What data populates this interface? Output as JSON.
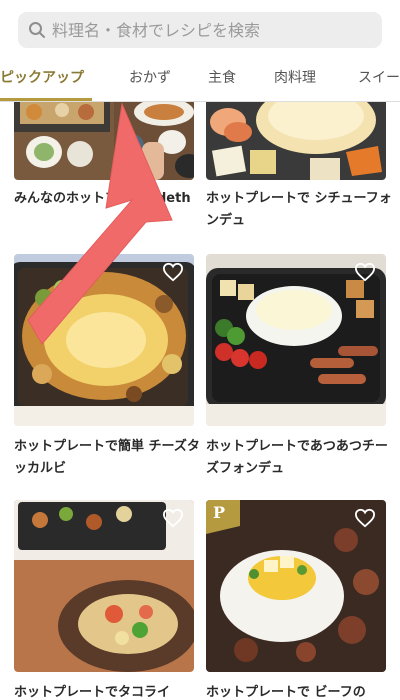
{
  "search": {
    "placeholder": "料理名・食材でレシピを検索"
  },
  "tabs": [
    {
      "label": "ピックアップ",
      "active": true
    },
    {
      "label": "おかず"
    },
    {
      "label": "主食"
    },
    {
      "label": "肉料理"
    },
    {
      "label": "スイー"
    }
  ],
  "recipes": [
    {
      "title": "みんなのホットプレートdeth"
    },
    {
      "title": "ホットプレートで シチューフォンデュ"
    },
    {
      "title": "ホットプレートで簡単 チーズタッカルビ"
    },
    {
      "title": "ホットプレートであつあつチーズフォンデュ"
    },
    {
      "title": "ホットプレートでタコライ"
    },
    {
      "title": "ホットプレートで ビーフの"
    }
  ],
  "badges": {
    "premium": "P"
  },
  "colors": {
    "accent": "#b59a40",
    "arrow": "#f06a6a"
  }
}
